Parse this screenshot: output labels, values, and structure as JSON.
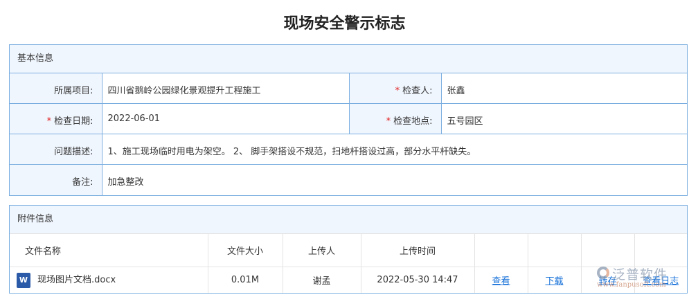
{
  "title": "现场安全警示标志",
  "basic": {
    "header": "基本信息",
    "project_label": "所属项目:",
    "project": "四川省鹅岭公园绿化景观提升工程施工",
    "inspector_label": "检查人:",
    "inspector": "张鑫",
    "date_label": "检查日期:",
    "date": "2022-06-01",
    "location_label": "检查地点:",
    "location": "五号园区",
    "issue_label": "问题描述:",
    "issue": "1、施工现场临时用电为架空。 2、 脚手架搭设不规范，扫地杆搭设过高，部分水平杆缺失。",
    "remark_label": "备注:",
    "remark": "加急整改",
    "required_mark": "*"
  },
  "attach": {
    "header": "附件信息",
    "columns": [
      "文件名称",
      "文件大小",
      "上传人",
      "上传时间"
    ],
    "rows": [
      {
        "name": "现场图片文档.docx",
        "size": "0.01M",
        "uploader": "谢孟",
        "time": "2022-05-30 14:47",
        "view": "查看",
        "download": "下载",
        "save": "转存",
        "log": "查看日志"
      }
    ]
  },
  "watermark": {
    "brand": "泛普软件",
    "url": "www.fanpusoft.com"
  }
}
